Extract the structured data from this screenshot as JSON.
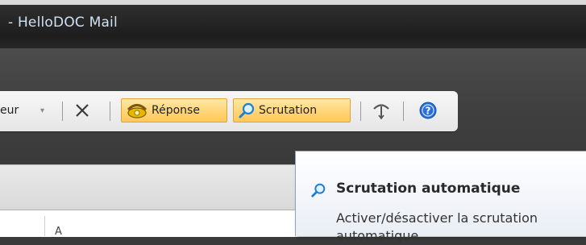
{
  "window": {
    "title": "- HelloDOC Mail"
  },
  "toolbar": {
    "dropdown_fragment": "eur",
    "dropdown_arrow": "▾",
    "close_glyph": "✕",
    "reponse_label": "Réponse",
    "scrutation_label": "Scrutation",
    "antenna_icon": "antenna-icon",
    "help_icon": "help-icon",
    "highlight_color": "#ffd67a"
  },
  "list": {
    "column_header": "A"
  },
  "tooltip": {
    "title": "Scrutation automatique",
    "description": "Activer/désactiver la scrutation automatique"
  }
}
